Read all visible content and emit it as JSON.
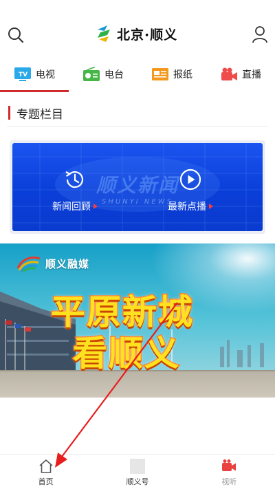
{
  "header": {
    "logo_text": "北京·顺义"
  },
  "categories": [
    {
      "label": "电视",
      "icon": "tv-icon",
      "active": true
    },
    {
      "label": "电台",
      "icon": "radio-icon",
      "active": false
    },
    {
      "label": "报纸",
      "icon": "newspaper-icon",
      "active": false
    },
    {
      "label": "直播",
      "icon": "live-camera-icon",
      "active": false
    }
  ],
  "section": {
    "title": "专题栏目"
  },
  "feature": {
    "bg_title": "顺义新闻",
    "bg_subtitle": "SHUNYI NEWS",
    "replay_label": "新闻回顾",
    "ondemand_label": "最新点播"
  },
  "promo": {
    "brand": "顺义融媒",
    "headline_line1": "平原新城",
    "headline_line2": "看顺义"
  },
  "tabbar": {
    "items": [
      {
        "label": "首页",
        "icon": "home-icon"
      },
      {
        "label": "顺义号",
        "icon": "image-placeholder-icon"
      },
      {
        "label": "视听",
        "icon": "video-camera-icon"
      }
    ]
  },
  "colors": {
    "accent": "#cf2b2b",
    "feature_blue": "#0a3ed8",
    "headline_yellow": "#ffe21f",
    "headline_orange": "#ff6a00"
  }
}
